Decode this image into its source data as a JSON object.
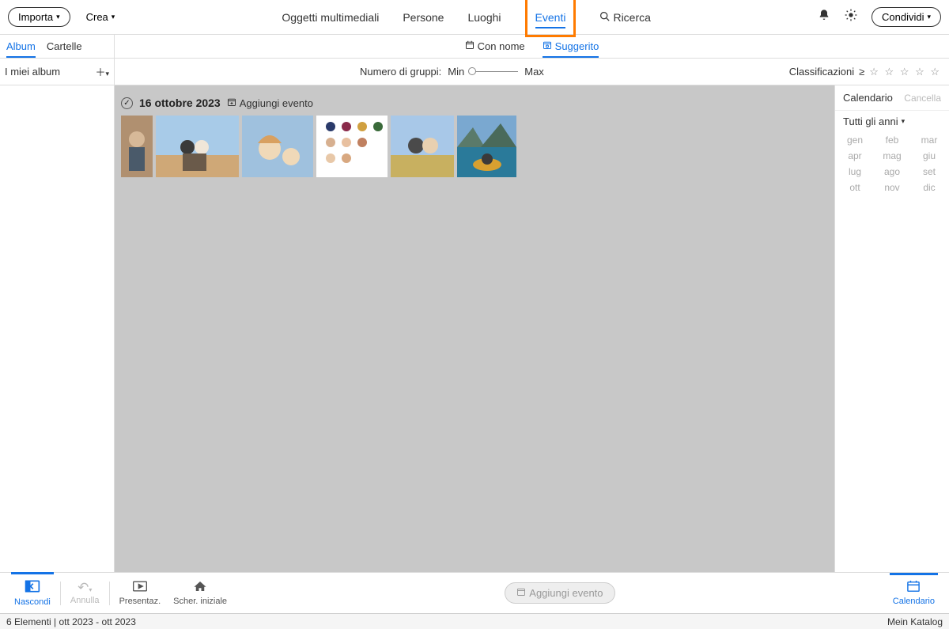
{
  "topbar": {
    "import_label": "Importa",
    "create_label": "Crea",
    "share_label": "Condividi"
  },
  "nav": {
    "media": "Oggetti multimediali",
    "people": "Persone",
    "places": "Luoghi",
    "events": "Eventi",
    "search": "Ricerca"
  },
  "subtabs": {
    "album": "Album",
    "folders": "Cartelle",
    "named": "Con nome",
    "suggested": "Suggerito"
  },
  "sidebar": {
    "my_albums": "I miei album"
  },
  "toolrow": {
    "groups_label": "Numero di gruppi:",
    "min": "Min",
    "max": "Max",
    "ratings": "Classificazioni",
    "gte": "≥"
  },
  "calendar": {
    "title": "Calendario",
    "clear": "Cancella",
    "year_select": "Tutti gli anni",
    "months": [
      [
        "gen",
        "feb",
        "mar"
      ],
      [
        "apr",
        "mag",
        "giu"
      ],
      [
        "lug",
        "ago",
        "set"
      ],
      [
        "ott",
        "nov",
        "dic"
      ]
    ]
  },
  "event": {
    "date": "16 ottobre 2023",
    "add_label": "Aggiungi evento"
  },
  "bottom": {
    "hide": "Nascondi",
    "undo": "Annulla",
    "present": "Presentaz.",
    "home": "Scher. iniziale",
    "add_event": "Aggiungi evento",
    "calendar": "Calendario"
  },
  "status": {
    "left": "6 Elementi |   ott 2023  - ott 2023",
    "right": "Mein Katalog"
  }
}
